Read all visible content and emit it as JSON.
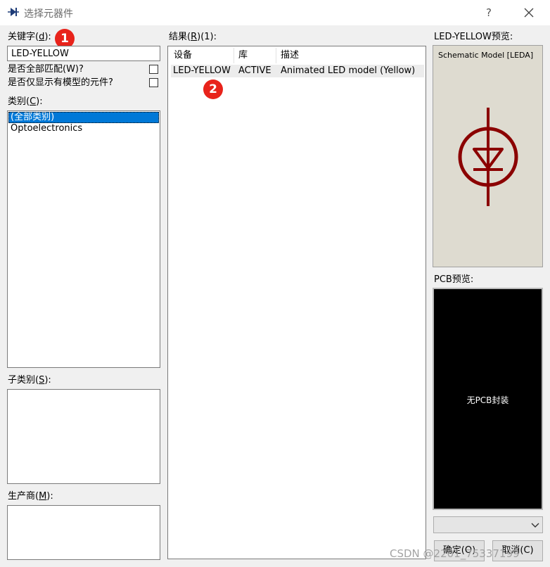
{
  "window": {
    "title": "选择元器件",
    "help_label": "?"
  },
  "left": {
    "keyword": {
      "label": "关键字(",
      "accel": "d",
      "label_end": "):",
      "value": "LED-YELLOW"
    },
    "match_all": {
      "label": "是否全部匹配(W)?"
    },
    "only_models": {
      "label": "是否仅显示有模型的元件?"
    },
    "category": {
      "label": "类别(",
      "accel": "C",
      "label_end": "):",
      "items": [
        "(全部类别)",
        "Optoelectronics"
      ]
    },
    "subcategory": {
      "label": "子类别(",
      "accel": "S",
      "label_end": "):"
    },
    "manufacturer": {
      "label": "生产商(",
      "accel": "M",
      "label_end": "):"
    }
  },
  "results": {
    "label": "结果(",
    "accel": "R",
    "label_end": ")(1):",
    "columns": [
      "设备",
      "库",
      "描述"
    ],
    "rows": [
      {
        "device": "LED-YELLOW",
        "library": "ACTIVE",
        "description": "Animated LED model (Yellow)"
      }
    ]
  },
  "preview": {
    "title": "LED-YELLOW预览:",
    "caption": "Schematic Model [LEDA]",
    "symbol_color": "#8b0000"
  },
  "pcb": {
    "title": "PCB预览:",
    "message": "无PCB封装"
  },
  "buttons": {
    "ok": "确定(O)",
    "cancel": "取消(C)"
  },
  "badges": [
    "1",
    "2"
  ],
  "watermark": "CSDN @2201_75337199",
  "colors": {
    "badge": "#e8231b",
    "selection": "#0078d7"
  }
}
